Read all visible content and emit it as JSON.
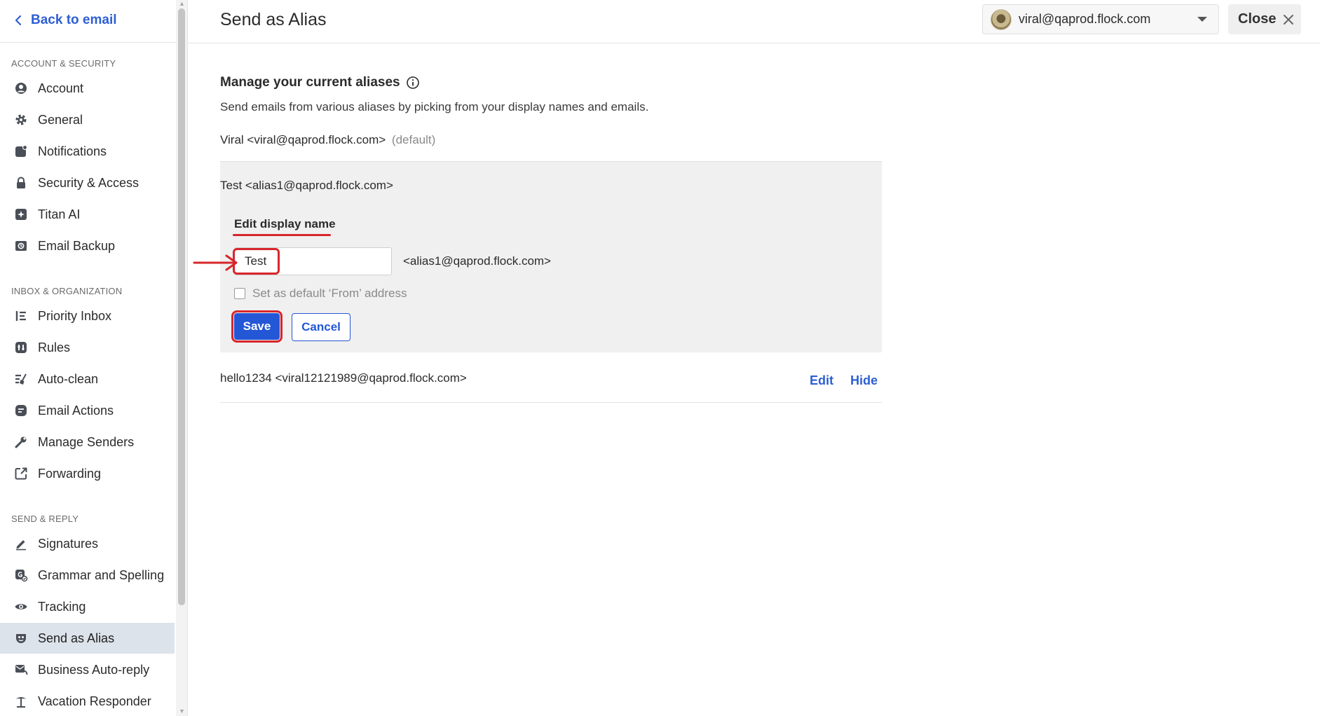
{
  "sidebar": {
    "back_label": "Back to email",
    "sections": {
      "account_security": "ACCOUNT & SECURITY",
      "inbox_organization": "INBOX & ORGANIZATION",
      "send_reply": "SEND & REPLY"
    },
    "items": {
      "account": "Account",
      "general": "General",
      "notifications": "Notifications",
      "security_access": "Security & Access",
      "titan_ai": "Titan AI",
      "email_backup": "Email Backup",
      "priority_inbox": "Priority Inbox",
      "rules": "Rules",
      "auto_clean": "Auto-clean",
      "email_actions": "Email Actions",
      "manage_senders": "Manage Senders",
      "forwarding": "Forwarding",
      "signatures": "Signatures",
      "grammar_spelling": "Grammar and Spelling",
      "tracking": "Tracking",
      "send_as_alias": "Send as Alias",
      "business_auto_reply": "Business Auto-reply",
      "vacation_responder": "Vacation Responder"
    },
    "active_item": "send_as_alias"
  },
  "header": {
    "title": "Send as Alias",
    "account_email": "viral@qaprod.flock.com",
    "close_label": "Close"
  },
  "main": {
    "section_title": "Manage your current aliases",
    "section_desc": "Send emails from various aliases by picking from your display names and emails.",
    "default_alias": "Viral <viral@qaprod.flock.com>",
    "default_tag": "(default)",
    "editing": {
      "alias_title": "Test <alias1@qaprod.flock.com>",
      "edit_label": "Edit display name",
      "display_name_value": "Test",
      "alias_suffix": "<alias1@qaprod.flock.com>",
      "default_checkbox_label": "Set as default ‘From’ address",
      "default_checked": false,
      "save_label": "Save",
      "cancel_label": "Cancel"
    },
    "other_alias": {
      "text": "hello1234 <viral12121989@qaprod.flock.com>",
      "edit_label": "Edit",
      "hide_label": "Hide"
    }
  },
  "colors": {
    "accent": "#2457d6",
    "link": "#2d5fd3",
    "annotation_red": "#d8262b",
    "active_nav_bg": "#dde3eb"
  }
}
